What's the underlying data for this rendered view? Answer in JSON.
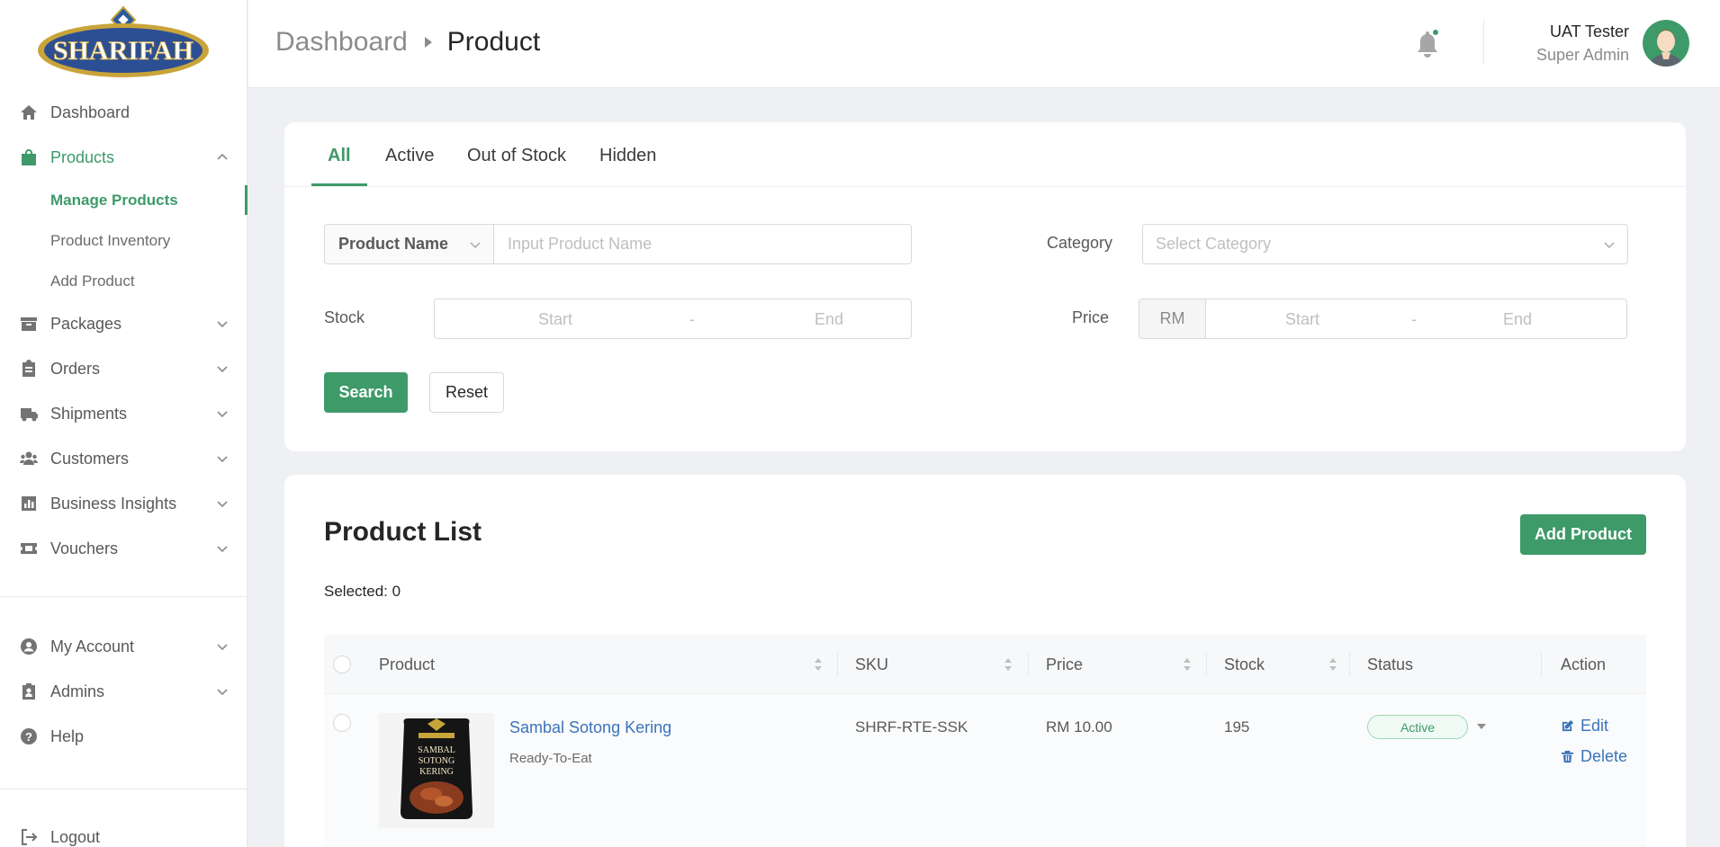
{
  "brand": {
    "logo_text": "SHARIFAH"
  },
  "sidebar": {
    "items": [
      {
        "label": "Dashboard",
        "icon": "home-icon"
      },
      {
        "label": "Products",
        "icon": "shopping-bag-icon"
      },
      {
        "label": "Packages",
        "icon": "box-icon"
      },
      {
        "label": "Orders",
        "icon": "clipboard-icon"
      },
      {
        "label": "Shipments",
        "icon": "truck-icon"
      },
      {
        "label": "Customers",
        "icon": "users-icon"
      },
      {
        "label": "Business Insights",
        "icon": "bar-chart-icon"
      },
      {
        "label": "Vouchers",
        "icon": "ticket-icon"
      }
    ],
    "sub_items": [
      "Manage Products",
      "Product Inventory",
      "Add Product"
    ],
    "bottom_items": [
      {
        "label": "My Account",
        "icon": "user-circle-icon"
      },
      {
        "label": "Admins",
        "icon": "id-badge-icon"
      },
      {
        "label": "Help",
        "icon": "help-icon"
      }
    ],
    "logout": "Logout"
  },
  "header": {
    "breadcrumb_root": "Dashboard",
    "breadcrumb_current": "Product",
    "user_name": "UAT Tester",
    "user_role": "Super Admin"
  },
  "filters": {
    "tabs": [
      "All",
      "Active",
      "Out of Stock",
      "Hidden"
    ],
    "active_tab": "All",
    "name_field_type": "Product Name",
    "name_placeholder": "Input Product Name",
    "category_label": "Category",
    "category_placeholder": "Select Category",
    "stock_label": "Stock",
    "price_label": "Price",
    "currency": "RM",
    "range_start": "Start",
    "range_end": "End",
    "range_sep": "-",
    "search_label": "Search",
    "reset_label": "Reset"
  },
  "product_list": {
    "title": "Product List",
    "add_label": "Add Product",
    "selected_text": "Selected: 0",
    "columns": [
      "Product",
      "SKU",
      "Price",
      "Stock",
      "Status",
      "Action"
    ],
    "rows": [
      {
        "name": "Sambal Sotong Kering",
        "category": "Ready-To-Eat",
        "sku": "SHRF-RTE-SSK",
        "price": "RM 10.00",
        "stock": "195",
        "status": "Active",
        "edit": "Edit",
        "delete": "Delete",
        "package_text": [
          "SAMBAL",
          "SOTONG",
          "KERING"
        ]
      }
    ]
  },
  "colors": {
    "accent": "#3e9a69",
    "link": "#3b73b9"
  }
}
